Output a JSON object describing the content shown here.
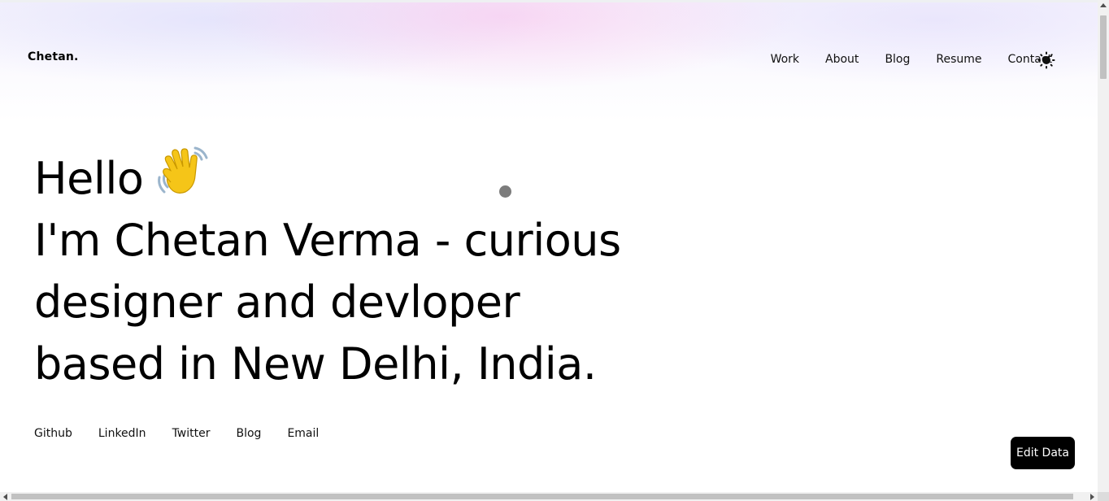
{
  "header": {
    "logo": "Chetan.",
    "nav": [
      "Work",
      "About",
      "Blog",
      "Resume",
      "Contact"
    ],
    "theme_icon": "sun-icon"
  },
  "hero": {
    "greeting": "Hello",
    "greeting_icon": "waving-hand-icon",
    "line2": "I'm Chetan Verma - curious",
    "line3": "designer and devloper",
    "line4": "based in New Delhi, India."
  },
  "social": [
    "Github",
    "LinkedIn",
    "Twitter",
    "Blog",
    "Email"
  ],
  "edit_button": "Edit Data",
  "colors": {
    "background": "#ffffff",
    "text": "#000000",
    "button_bg": "#000000",
    "button_text": "#ffffff",
    "glow_pink": "#f8beeb",
    "glow_lavender": "#d7d7fa"
  }
}
